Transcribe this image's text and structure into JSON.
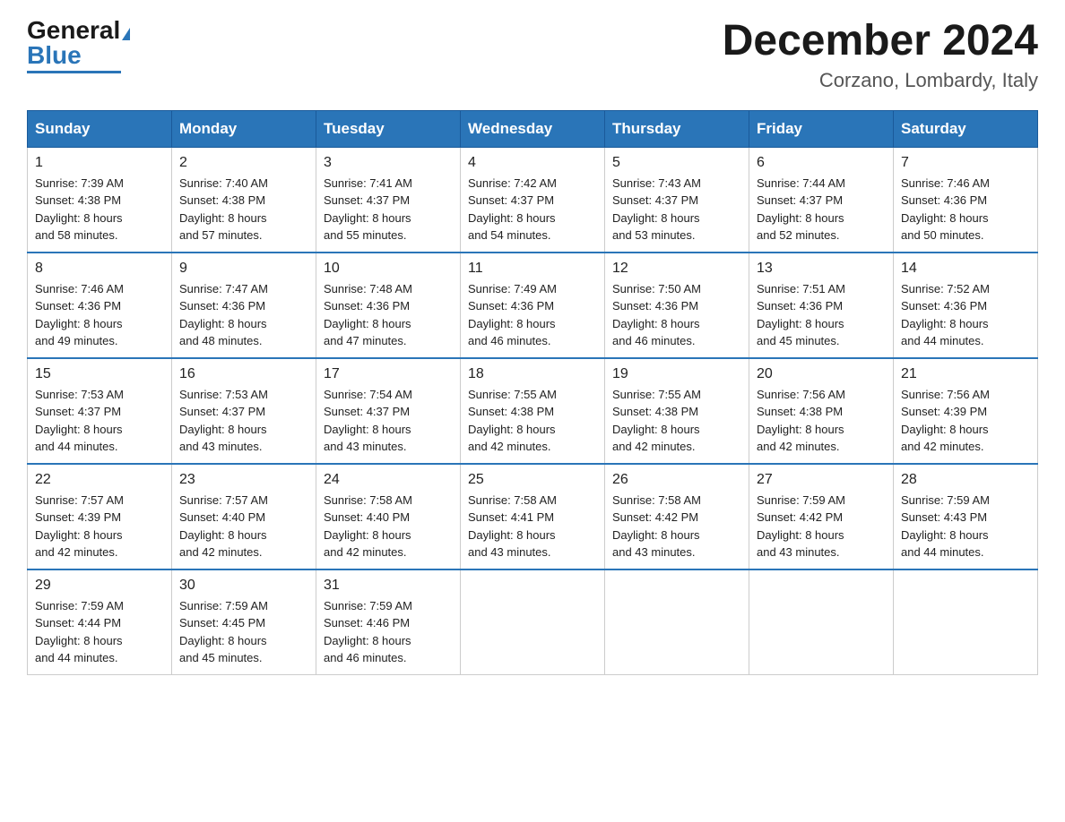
{
  "header": {
    "logo_general": "General",
    "logo_blue": "Blue",
    "month_title": "December 2024",
    "location": "Corzano, Lombardy, Italy"
  },
  "days_of_week": [
    "Sunday",
    "Monday",
    "Tuesday",
    "Wednesday",
    "Thursday",
    "Friday",
    "Saturday"
  ],
  "weeks": [
    [
      {
        "day": "1",
        "sunrise": "7:39 AM",
        "sunset": "4:38 PM",
        "daylight": "8 hours and 58 minutes."
      },
      {
        "day": "2",
        "sunrise": "7:40 AM",
        "sunset": "4:38 PM",
        "daylight": "8 hours and 57 minutes."
      },
      {
        "day": "3",
        "sunrise": "7:41 AM",
        "sunset": "4:37 PM",
        "daylight": "8 hours and 55 minutes."
      },
      {
        "day": "4",
        "sunrise": "7:42 AM",
        "sunset": "4:37 PM",
        "daylight": "8 hours and 54 minutes."
      },
      {
        "day": "5",
        "sunrise": "7:43 AM",
        "sunset": "4:37 PM",
        "daylight": "8 hours and 53 minutes."
      },
      {
        "day": "6",
        "sunrise": "7:44 AM",
        "sunset": "4:37 PM",
        "daylight": "8 hours and 52 minutes."
      },
      {
        "day": "7",
        "sunrise": "7:46 AM",
        "sunset": "4:36 PM",
        "daylight": "8 hours and 50 minutes."
      }
    ],
    [
      {
        "day": "8",
        "sunrise": "7:46 AM",
        "sunset": "4:36 PM",
        "daylight": "8 hours and 49 minutes."
      },
      {
        "day": "9",
        "sunrise": "7:47 AM",
        "sunset": "4:36 PM",
        "daylight": "8 hours and 48 minutes."
      },
      {
        "day": "10",
        "sunrise": "7:48 AM",
        "sunset": "4:36 PM",
        "daylight": "8 hours and 47 minutes."
      },
      {
        "day": "11",
        "sunrise": "7:49 AM",
        "sunset": "4:36 PM",
        "daylight": "8 hours and 46 minutes."
      },
      {
        "day": "12",
        "sunrise": "7:50 AM",
        "sunset": "4:36 PM",
        "daylight": "8 hours and 46 minutes."
      },
      {
        "day": "13",
        "sunrise": "7:51 AM",
        "sunset": "4:36 PM",
        "daylight": "8 hours and 45 minutes."
      },
      {
        "day": "14",
        "sunrise": "7:52 AM",
        "sunset": "4:36 PM",
        "daylight": "8 hours and 44 minutes."
      }
    ],
    [
      {
        "day": "15",
        "sunrise": "7:53 AM",
        "sunset": "4:37 PM",
        "daylight": "8 hours and 44 minutes."
      },
      {
        "day": "16",
        "sunrise": "7:53 AM",
        "sunset": "4:37 PM",
        "daylight": "8 hours and 43 minutes."
      },
      {
        "day": "17",
        "sunrise": "7:54 AM",
        "sunset": "4:37 PM",
        "daylight": "8 hours and 43 minutes."
      },
      {
        "day": "18",
        "sunrise": "7:55 AM",
        "sunset": "4:38 PM",
        "daylight": "8 hours and 42 minutes."
      },
      {
        "day": "19",
        "sunrise": "7:55 AM",
        "sunset": "4:38 PM",
        "daylight": "8 hours and 42 minutes."
      },
      {
        "day": "20",
        "sunrise": "7:56 AM",
        "sunset": "4:38 PM",
        "daylight": "8 hours and 42 minutes."
      },
      {
        "day": "21",
        "sunrise": "7:56 AM",
        "sunset": "4:39 PM",
        "daylight": "8 hours and 42 minutes."
      }
    ],
    [
      {
        "day": "22",
        "sunrise": "7:57 AM",
        "sunset": "4:39 PM",
        "daylight": "8 hours and 42 minutes."
      },
      {
        "day": "23",
        "sunrise": "7:57 AM",
        "sunset": "4:40 PM",
        "daylight": "8 hours and 42 minutes."
      },
      {
        "day": "24",
        "sunrise": "7:58 AM",
        "sunset": "4:40 PM",
        "daylight": "8 hours and 42 minutes."
      },
      {
        "day": "25",
        "sunrise": "7:58 AM",
        "sunset": "4:41 PM",
        "daylight": "8 hours and 43 minutes."
      },
      {
        "day": "26",
        "sunrise": "7:58 AM",
        "sunset": "4:42 PM",
        "daylight": "8 hours and 43 minutes."
      },
      {
        "day": "27",
        "sunrise": "7:59 AM",
        "sunset": "4:42 PM",
        "daylight": "8 hours and 43 minutes."
      },
      {
        "day": "28",
        "sunrise": "7:59 AM",
        "sunset": "4:43 PM",
        "daylight": "8 hours and 44 minutes."
      }
    ],
    [
      {
        "day": "29",
        "sunrise": "7:59 AM",
        "sunset": "4:44 PM",
        "daylight": "8 hours and 44 minutes."
      },
      {
        "day": "30",
        "sunrise": "7:59 AM",
        "sunset": "4:45 PM",
        "daylight": "8 hours and 45 minutes."
      },
      {
        "day": "31",
        "sunrise": "7:59 AM",
        "sunset": "4:46 PM",
        "daylight": "8 hours and 46 minutes."
      },
      null,
      null,
      null,
      null
    ]
  ],
  "labels": {
    "sunrise_prefix": "Sunrise: ",
    "sunset_prefix": "Sunset: ",
    "daylight_prefix": "Daylight: "
  }
}
